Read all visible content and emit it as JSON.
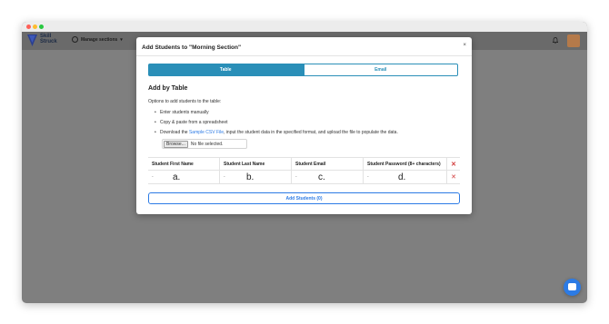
{
  "app": {
    "brand_line1": "Skill",
    "brand_line2": "Struck",
    "sections_label": "Manage sections"
  },
  "modal": {
    "title": "Add Students to \"Morning Section\"",
    "close": "×",
    "tabs": [
      {
        "label": "Table",
        "active": true
      },
      {
        "label": "Email",
        "active": false
      }
    ],
    "heading": "Add by Table",
    "intro": "Options to add students to the table:",
    "options": [
      "Enter students manually",
      "Copy & paste from a spreadsheet"
    ],
    "download_prefix": "Download the ",
    "download_link": "Sample CSV File",
    "download_suffix": ", input the student data in the specified format, and upload the file to populate the data.",
    "browse_label": "Browse...",
    "file_status": "No file selected.",
    "table": {
      "columns": [
        "Student First Name",
        "Student Last Name",
        "Student Email",
        "Student Password (8+ characters)"
      ],
      "remove": "✕",
      "row_placeholder": "-",
      "annotations": [
        "a.",
        "b.",
        "c.",
        "d."
      ]
    },
    "add_button": "Add Students (0)"
  },
  "colors": {
    "accent": "#2a8fb8",
    "link": "#2c7be5",
    "danger": "#d23b3b",
    "overlay": "#7f7f7f"
  },
  "icons": [
    "clock-icon",
    "chevron-down-icon",
    "bell-icon",
    "close-icon",
    "remove-row-icon",
    "chat-icon"
  ]
}
